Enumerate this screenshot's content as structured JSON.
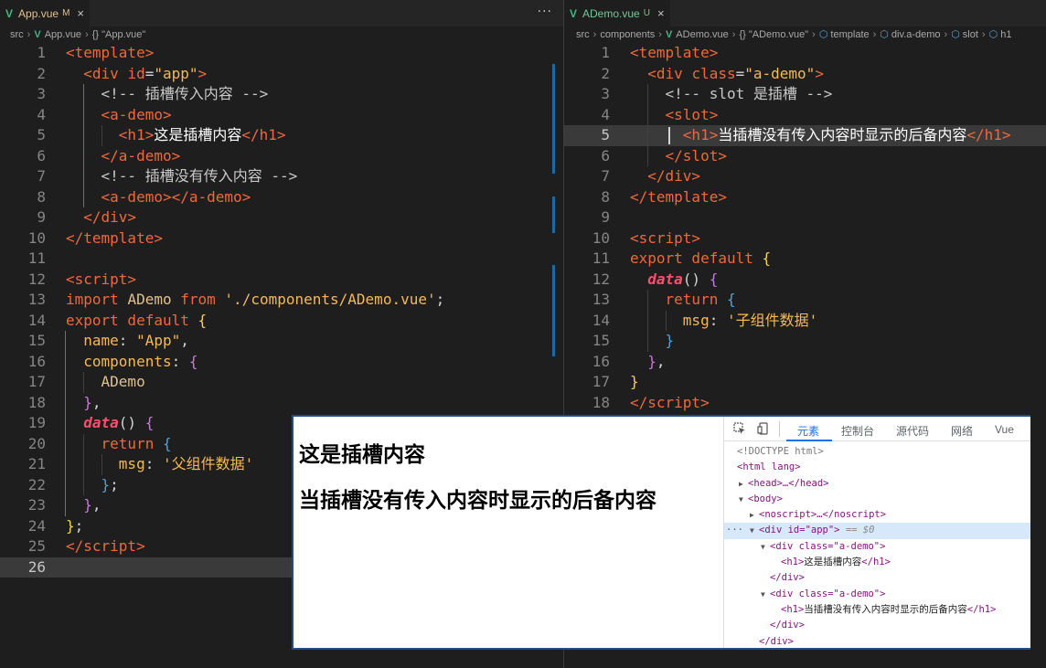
{
  "left_editor": {
    "tab": {
      "icon": "V",
      "name": "App.vue",
      "status": "M",
      "close": "×"
    },
    "more": "···",
    "breadcrumb": [
      "src",
      "App.vue",
      "{} \"App.vue\""
    ]
  },
  "right_editor": {
    "tab": {
      "icon": "V",
      "name": "ADemo.vue",
      "status": "U",
      "close": "×"
    },
    "breadcrumb": [
      "src",
      "components",
      "ADemo.vue",
      "{} \"ADemo.vue\"",
      "template",
      "div.a-demo",
      "slot",
      "h1"
    ]
  },
  "browser": {
    "h1_first": "这是插槽内容",
    "h1_second": "当插槽没有传入内容时显示的后备内容"
  },
  "devtools": {
    "tabs": [
      "元素",
      "控制台",
      "源代码",
      "网络",
      "Vue"
    ],
    "active_tab": "元素",
    "dom": {
      "doctype": "<!DOCTYPE html>",
      "html_open": "<html lang>",
      "head": "<head>…</head>",
      "body_open": "<body>",
      "noscript": "<noscript>…</noscript>",
      "div_app": "<div id=\"app\">",
      "selected_marker": "== $0",
      "div_ademo": "<div class=\"a-demo\">",
      "h1_first": "这是插槽内容",
      "div_close": "</div>",
      "h1_second": "当插槽没有传入内容时显示的后备内容"
    }
  }
}
